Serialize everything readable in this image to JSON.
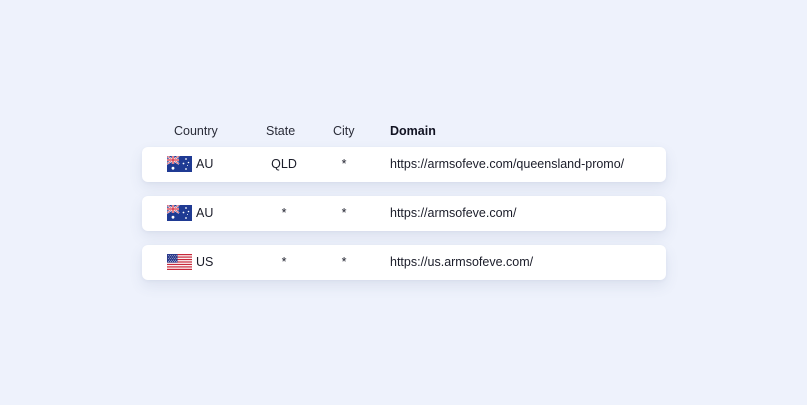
{
  "headers": {
    "country": "Country",
    "state": "State",
    "city": "City",
    "domain": "Domain"
  },
  "rows": [
    {
      "flag": "australia-flag-icon",
      "country": "AU",
      "state": "QLD",
      "city": "*",
      "domain": "https://armsofeve.com/queensland-promo/"
    },
    {
      "flag": "australia-flag-icon",
      "country": "AU",
      "state": "*",
      "city": "*",
      "domain": "https://armsofeve.com/"
    },
    {
      "flag": "us-flag-icon",
      "country": "US",
      "state": "*",
      "city": "*",
      "domain": "https://us.armsofeve.com/"
    }
  ],
  "colors": {
    "background": "#eef2fc",
    "row_background": "#ffffff",
    "text": "#1b1d2a"
  }
}
